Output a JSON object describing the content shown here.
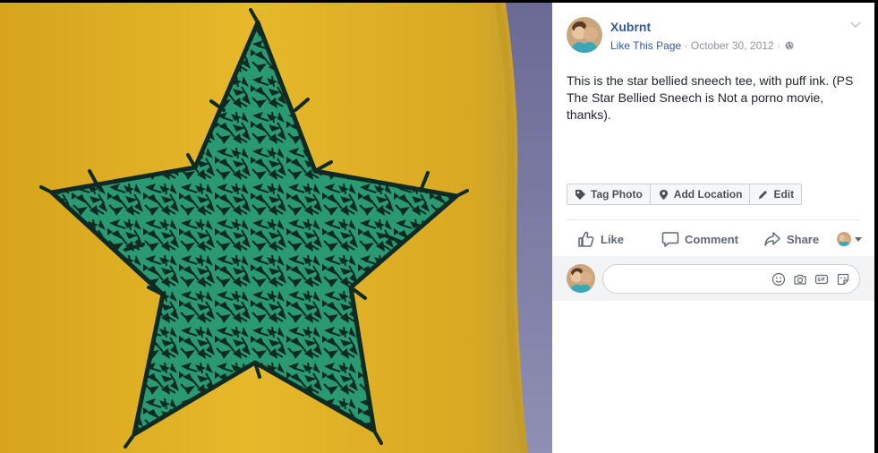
{
  "post": {
    "author": "Xubrnt",
    "like_page": "Like This Page",
    "separator": "·",
    "date": "October 30, 2012",
    "caption": "This is the star bellied sneech tee, with puff ink. (PS The Star Bellied Sneech is Not a porno movie, thanks)."
  },
  "photo_actions": {
    "tag": "Tag Photo",
    "location": "Add Location",
    "edit": "Edit"
  },
  "ufi": {
    "like": "Like",
    "comment": "Comment",
    "share": "Share"
  },
  "icons": {
    "globe": "globe-icon",
    "chevron": "chevron-down-icon",
    "tag": "tag-icon",
    "location": "location-pin-icon",
    "edit": "pencil-icon",
    "like": "thumbs-up-icon",
    "comment": "comment-bubble-icon",
    "share": "share-arrow-icon",
    "emoji": "emoji-icon",
    "camera": "camera-icon",
    "gif": "gif-icon",
    "sticker": "sticker-icon"
  },
  "colors": {
    "link": "#365899",
    "shirt": "#e2b325",
    "star": "#2b9b72"
  }
}
